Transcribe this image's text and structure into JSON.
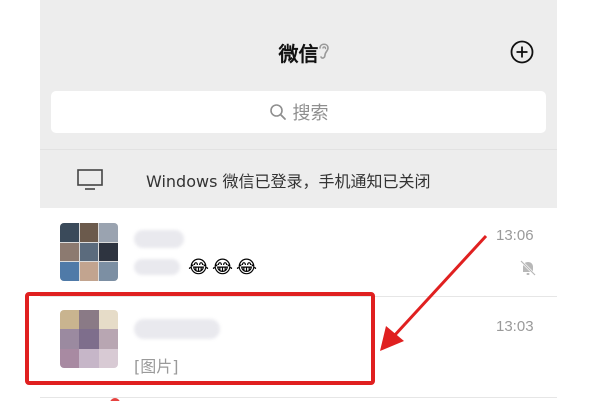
{
  "header": {
    "title": "微信"
  },
  "search": {
    "placeholder": "搜索"
  },
  "notice": {
    "text": "Windows 微信已登录，手机通知已关闭"
  },
  "chats": [
    {
      "time": "13:06",
      "emojis": [
        "😂",
        "😂",
        "😂"
      ],
      "muted": true
    },
    {
      "time": "13:03",
      "preview": "[图片]"
    }
  ],
  "colors": {
    "background": "#ededed",
    "highlight": "#e02020",
    "unread_dot": "#e64340"
  },
  "icons": {
    "ear": "ear-icon",
    "add": "add-circle-icon",
    "search": "search-icon",
    "monitor": "monitor-icon",
    "mute": "mute-bell-icon"
  }
}
